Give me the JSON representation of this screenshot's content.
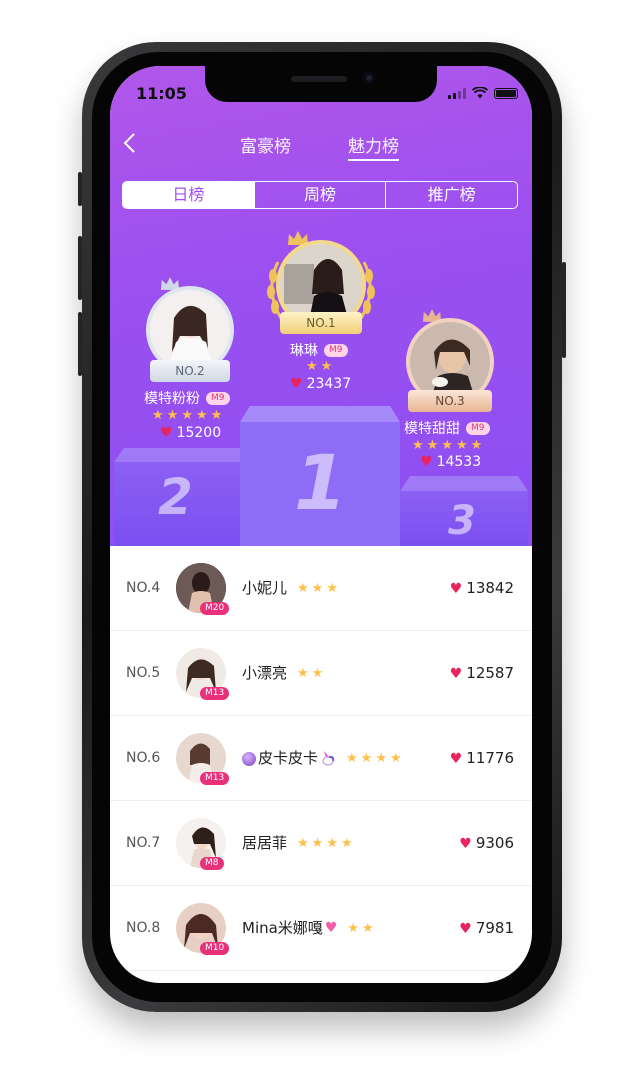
{
  "status": {
    "time": "11:05"
  },
  "nav": {
    "back_icon": "chevron-left-icon",
    "tabs": [
      "富豪榜",
      "魅力榜"
    ],
    "active_tab": 1
  },
  "segments": {
    "items": [
      "日榜",
      "周榜",
      "推广榜"
    ],
    "active": 0
  },
  "podium": {
    "first": {
      "rank_label": "NO.1",
      "name": "琳琳",
      "level": "M9",
      "stars": 2,
      "likes": "23437",
      "block_number": "1"
    },
    "second": {
      "rank_label": "NO.2",
      "name": "模特粉粉",
      "level": "M9",
      "stars": 5,
      "likes": "15200",
      "block_number": "2"
    },
    "third": {
      "rank_label": "NO.3",
      "name": "模特甜甜",
      "level": "M9",
      "stars": 5,
      "likes": "14533",
      "block_number": "3"
    }
  },
  "list": [
    {
      "rank": "NO.4",
      "name": "小妮儿",
      "level": "M20",
      "stars": 3,
      "likes": "13842"
    },
    {
      "rank": "NO.5",
      "name": "小漂亮",
      "level": "M13",
      "stars": 2,
      "likes": "12587"
    },
    {
      "rank": "NO.6",
      "name": "皮卡皮卡",
      "level": "M13",
      "stars": 4,
      "likes": "11776",
      "prefix_icon": "crystal-ball-icon",
      "suffix_icon": "unicorn-icon"
    },
    {
      "rank": "NO.7",
      "name": "居居菲",
      "level": "M8",
      "stars": 4,
      "likes": "9306"
    },
    {
      "rank": "NO.8",
      "name": "Mina米娜嘎",
      "level": "M10",
      "stars": 2,
      "likes": "7981",
      "suffix_icon": "sparkling-heart-icon"
    }
  ],
  "colors": {
    "accent": "#a54ff0",
    "heart": "#e8235e",
    "star": "#ffc04a",
    "level_badge": "#e8317a"
  }
}
